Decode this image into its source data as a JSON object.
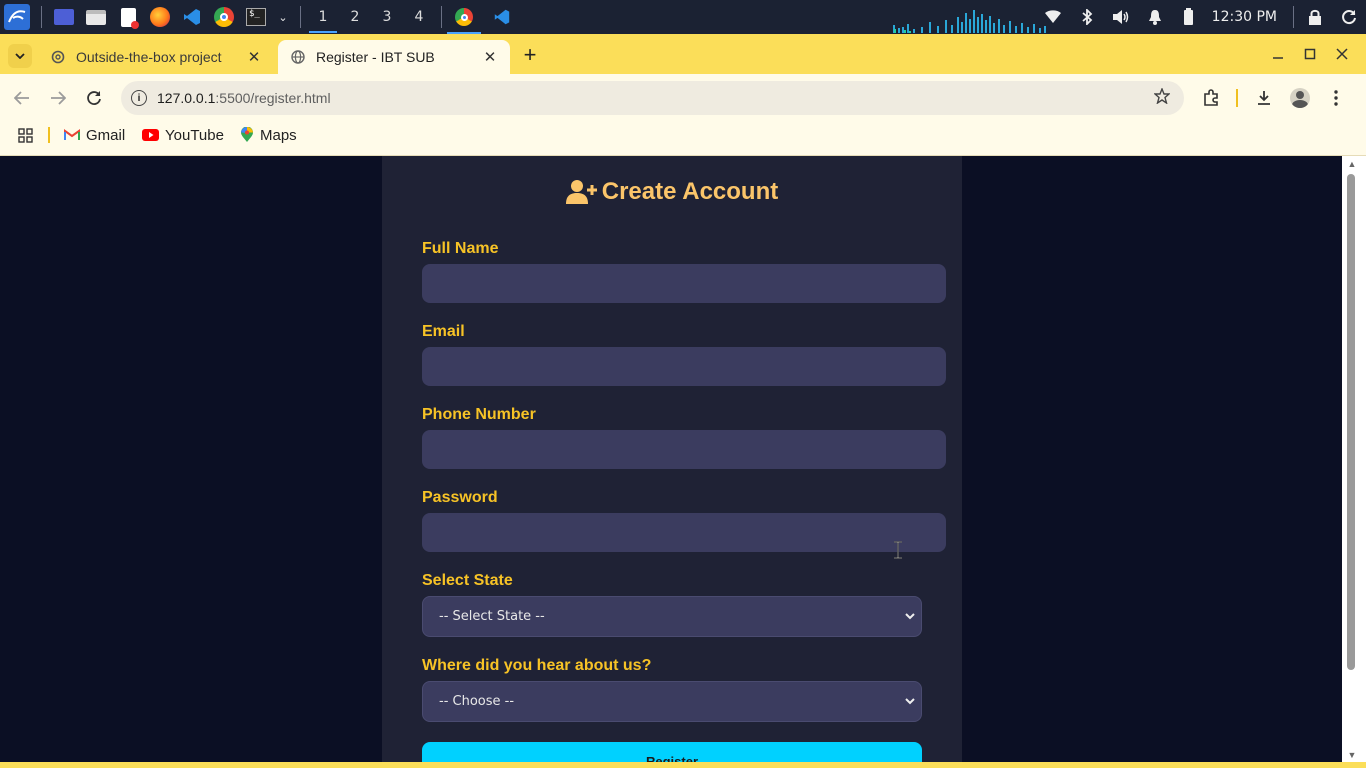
{
  "taskbar": {
    "workspaces": [
      "1",
      "2",
      "3",
      "4"
    ],
    "clock": "12:30 PM"
  },
  "browser": {
    "tabs": [
      {
        "title": "Outside-the-box project"
      },
      {
        "title": "Register - IBT SUB"
      }
    ],
    "url_host": "127.0.0.1",
    "url_path": ":5500/register.html",
    "bookmarks": [
      {
        "label": "Gmail"
      },
      {
        "label": "YouTube"
      },
      {
        "label": "Maps"
      }
    ]
  },
  "form": {
    "title": "Create Account",
    "fields": [
      {
        "label": "Full Name",
        "value": ""
      },
      {
        "label": "Email",
        "value": ""
      },
      {
        "label": "Phone Number",
        "value": ""
      },
      {
        "label": "Password",
        "value": ""
      }
    ],
    "state_label": "Select State",
    "state_selected": "-- Select State --",
    "hear_label": "Where did you hear about us?",
    "hear_selected": "-- Choose --",
    "submit_label": "Register"
  },
  "colors": {
    "page_bg": "#0b0f24",
    "card_bg": "#1f2235",
    "label": "#f7c326",
    "title": "#fbc56a",
    "input_bg": "#3b3c5f",
    "button": "#00d1ff",
    "browser_accent": "#fbde59"
  }
}
